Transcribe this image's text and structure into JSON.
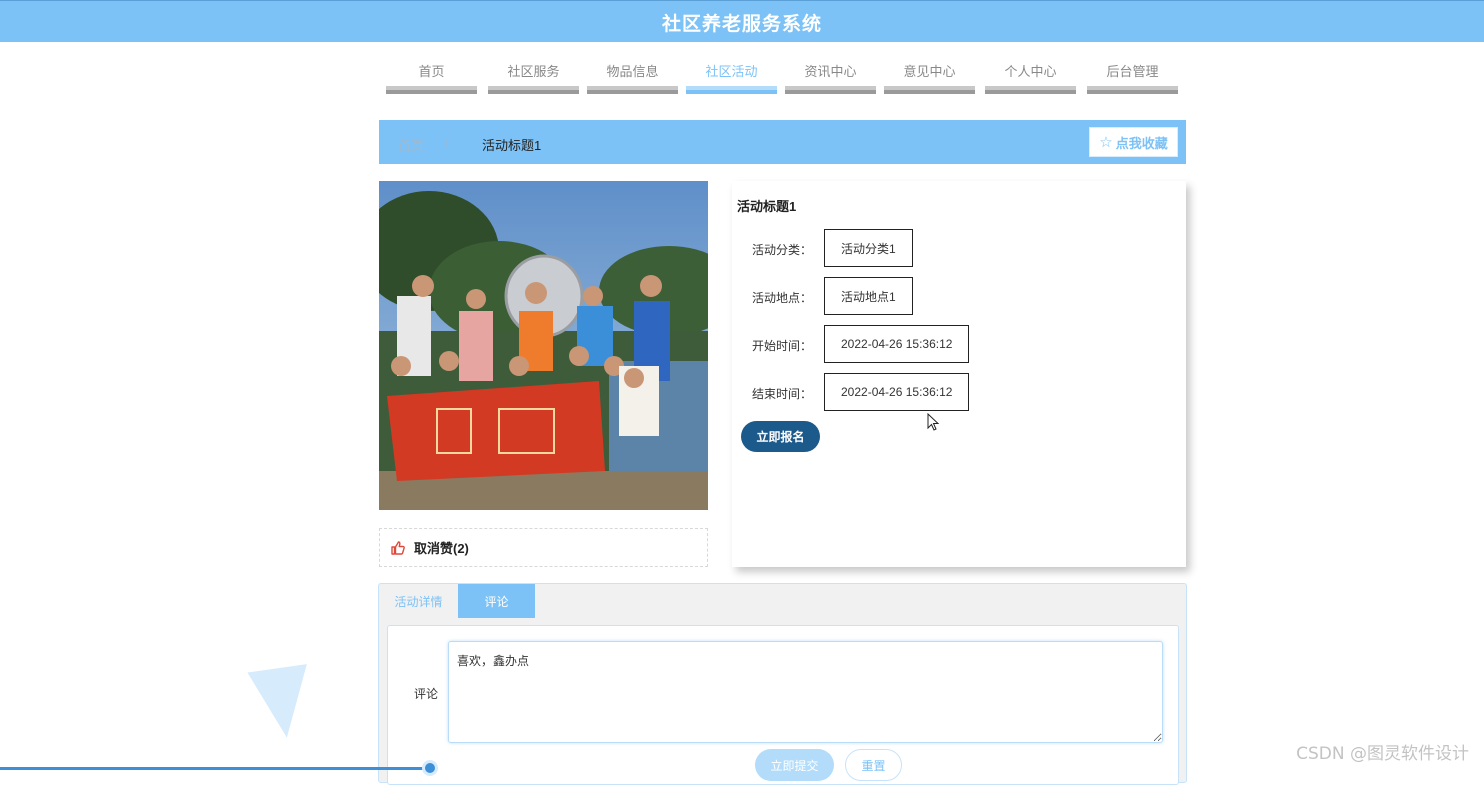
{
  "app": {
    "title": "社区养老服务系统"
  },
  "nav": {
    "items": [
      {
        "label": "首页"
      },
      {
        "label": "社区服务"
      },
      {
        "label": "物品信息"
      },
      {
        "label": "社区活动"
      },
      {
        "label": "资讯中心"
      },
      {
        "label": "意见中心"
      },
      {
        "label": "个人中心"
      },
      {
        "label": "后台管理"
      }
    ],
    "active": "社区活动"
  },
  "breadcrumb": {
    "home": "首页",
    "separator": "/",
    "current": "活动标题1",
    "favorite_label": "点我收藏",
    "favorite_icon": "star-outline-icon"
  },
  "photo": {
    "icon": "activity-photo"
  },
  "like": {
    "label": "取消赞(2)",
    "icon": "thumbs-up-icon"
  },
  "activity": {
    "title": "活动标题1",
    "fields": [
      {
        "label": "活动分类：",
        "value": "活动分类1"
      },
      {
        "label": "活动地点：",
        "value": "活动地点1"
      },
      {
        "label": "开始时间：",
        "value": "2022-04-26 15:36:12"
      },
      {
        "label": "结束时间：",
        "value": "2022-04-26 15:36:12"
      }
    ],
    "signup_label": "立即报名"
  },
  "tabs": [
    {
      "label": "活动详情"
    },
    {
      "label": "评论"
    }
  ],
  "comment": {
    "label": "评论",
    "value": "喜欢，鑫办点",
    "submit_label": "立即提交",
    "reset_label": "重置"
  },
  "watermark": "CSDN @图灵软件设计",
  "colors": {
    "primary": "#7dc2f6",
    "dark_button": "#1d5a8c",
    "accent_line": "#3d8fd8"
  }
}
